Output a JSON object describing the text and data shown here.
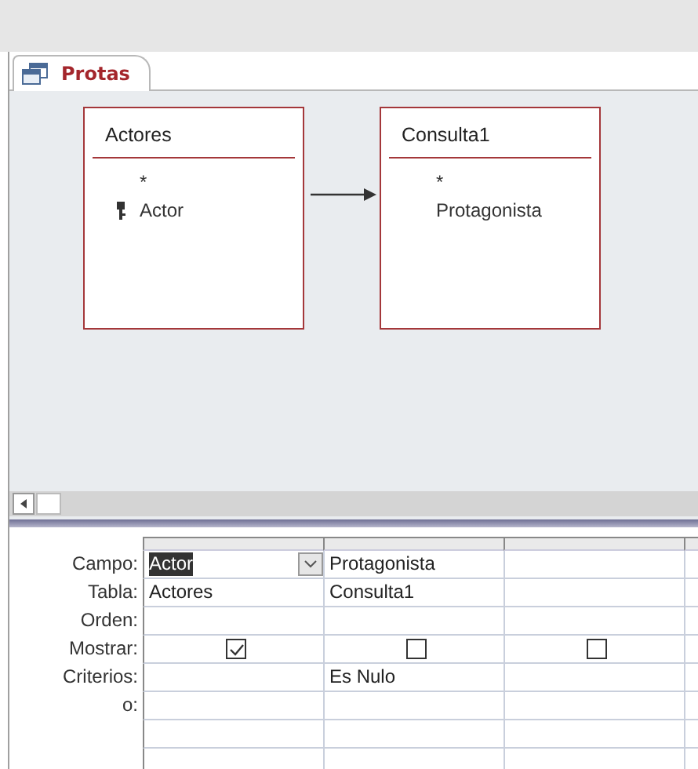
{
  "tab": {
    "label": "Protas",
    "selected": true
  },
  "tables": [
    {
      "name": "Actores",
      "fields": [
        {
          "name": "*",
          "key": false
        },
        {
          "name": "Actor",
          "key": true
        }
      ]
    },
    {
      "name": "Consulta1",
      "fields": [
        {
          "name": "*",
          "key": false
        },
        {
          "name": "Protagonista",
          "key": false
        }
      ]
    }
  ],
  "grid": {
    "rows": [
      {
        "label": "Campo:",
        "kind": "field"
      },
      {
        "label": "Tabla:",
        "kind": "table"
      },
      {
        "label": "Orden:",
        "kind": "sort"
      },
      {
        "label": "Mostrar:",
        "kind": "show"
      },
      {
        "label": "Criterios:",
        "kind": "criteria"
      },
      {
        "label": "o:",
        "kind": "or"
      }
    ],
    "columns": [
      {
        "field": "Actor",
        "field_selected": true,
        "table": "Actores",
        "show": true
      },
      {
        "field": "Protagonista",
        "field_selected": false,
        "table": "Consulta1",
        "show": false,
        "criteria": "Es Nulo"
      },
      {
        "show": false
      }
    ]
  }
}
